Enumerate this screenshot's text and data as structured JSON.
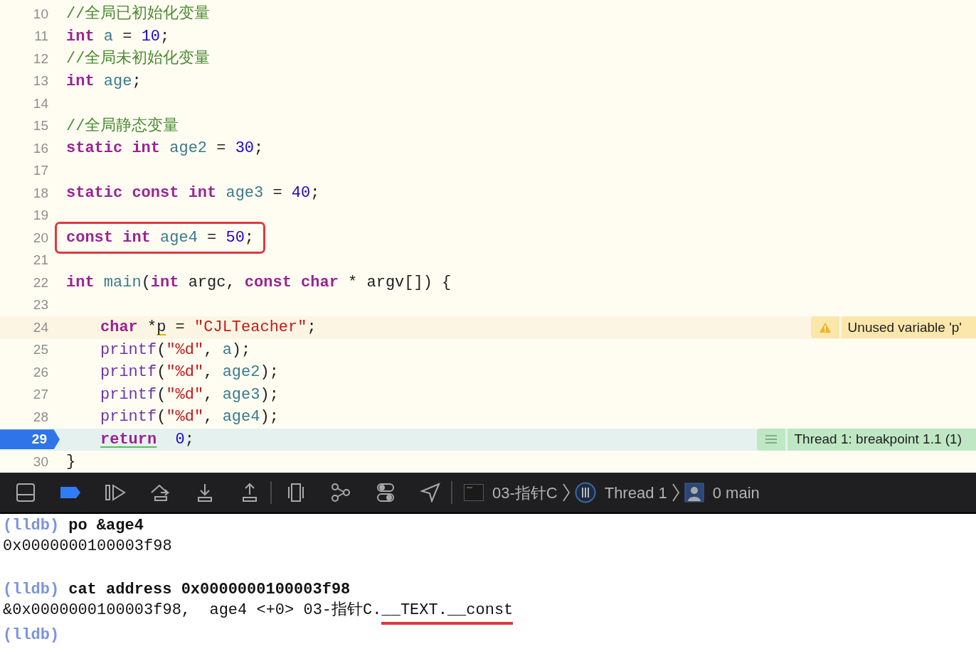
{
  "editor": {
    "lines": [
      {
        "number": "10",
        "tokens": [
          {
            "text": "//全局已初始化变量",
            "kind": "comment"
          }
        ]
      },
      {
        "number": "11",
        "tokens": [
          {
            "text": "int ",
            "kind": "keyword"
          },
          {
            "text": "a",
            "kind": "ident"
          },
          {
            "text": " = ",
            "kind": "plain"
          },
          {
            "text": "10",
            "kind": "number"
          },
          {
            "text": ";",
            "kind": "plain"
          }
        ]
      },
      {
        "number": "12",
        "tokens": [
          {
            "text": "//全局未初始化变量",
            "kind": "comment"
          }
        ]
      },
      {
        "number": "13",
        "tokens": [
          {
            "text": "int ",
            "kind": "keyword"
          },
          {
            "text": "age",
            "kind": "ident"
          },
          {
            "text": ";",
            "kind": "plain"
          }
        ]
      },
      {
        "number": "14"
      },
      {
        "number": "15",
        "tokens": [
          {
            "text": "//全局静态变量",
            "kind": "comment"
          }
        ]
      },
      {
        "number": "16",
        "tokens": [
          {
            "text": "static int ",
            "kind": "keyword"
          },
          {
            "text": "age2",
            "kind": "ident"
          },
          {
            "text": " = ",
            "kind": "plain"
          },
          {
            "text": "30",
            "kind": "number"
          },
          {
            "text": ";",
            "kind": "plain"
          }
        ]
      },
      {
        "number": "17"
      },
      {
        "number": "18",
        "tokens": [
          {
            "text": "static const int ",
            "kind": "keyword"
          },
          {
            "text": "age3",
            "kind": "ident"
          },
          {
            "text": " = ",
            "kind": "plain"
          },
          {
            "text": "40",
            "kind": "number"
          },
          {
            "text": ";",
            "kind": "plain"
          }
        ]
      },
      {
        "number": "19"
      },
      {
        "number": "20",
        "boxed": true,
        "tokens": [
          {
            "text": "const int ",
            "kind": "keyword"
          },
          {
            "text": "age4",
            "kind": "ident"
          },
          {
            "text": " = ",
            "kind": "plain"
          },
          {
            "text": "50",
            "kind": "number"
          },
          {
            "text": ";",
            "kind": "plain"
          }
        ]
      },
      {
        "number": "21"
      },
      {
        "number": "22",
        "tokens": [
          {
            "text": "int ",
            "kind": "keyword"
          },
          {
            "text": "main",
            "kind": "ident"
          },
          {
            "text": "(",
            "kind": "plain"
          },
          {
            "text": "int",
            "kind": "keyword"
          },
          {
            "text": " argc, ",
            "kind": "plain"
          },
          {
            "text": "const char",
            "kind": "keyword"
          },
          {
            "text": " * argv[]) {",
            "kind": "plain"
          }
        ]
      },
      {
        "number": "23"
      },
      {
        "number": "24",
        "indented": true,
        "annotation": {
          "kind": "warning",
          "text": "Unused variable 'p'"
        },
        "tokens": [
          {
            "text": "char",
            "kind": "keyword"
          },
          {
            "text": " *",
            "kind": "plain"
          },
          {
            "text": "p",
            "kind": "plain",
            "underlined": true
          },
          {
            "text": " = ",
            "kind": "plain"
          },
          {
            "text": "\"CJLTeacher\"",
            "kind": "string"
          },
          {
            "text": ";",
            "kind": "plain"
          }
        ]
      },
      {
        "number": "25",
        "indented": true,
        "tokens": [
          {
            "text": "printf",
            "kind": "func"
          },
          {
            "text": "(",
            "kind": "plain"
          },
          {
            "text": "\"%d\"",
            "kind": "string"
          },
          {
            "text": ", ",
            "kind": "plain"
          },
          {
            "text": "a",
            "kind": "ident"
          },
          {
            "text": ");",
            "kind": "plain"
          }
        ]
      },
      {
        "number": "26",
        "indented": true,
        "tokens": [
          {
            "text": "printf",
            "kind": "func"
          },
          {
            "text": "(",
            "kind": "plain"
          },
          {
            "text": "\"%d\"",
            "kind": "string"
          },
          {
            "text": ", ",
            "kind": "plain"
          },
          {
            "text": "age2",
            "kind": "ident"
          },
          {
            "text": ");",
            "kind": "plain"
          }
        ]
      },
      {
        "number": "27",
        "indented": true,
        "tokens": [
          {
            "text": "printf",
            "kind": "func"
          },
          {
            "text": "(",
            "kind": "plain"
          },
          {
            "text": "\"%d\"",
            "kind": "string"
          },
          {
            "text": ", ",
            "kind": "plain"
          },
          {
            "text": "age3",
            "kind": "ident"
          },
          {
            "text": ");",
            "kind": "plain"
          }
        ]
      },
      {
        "number": "28",
        "indented": true,
        "tokens": [
          {
            "text": "printf",
            "kind": "func"
          },
          {
            "text": "(",
            "kind": "plain"
          },
          {
            "text": "\"%d\"",
            "kind": "string"
          },
          {
            "text": ", ",
            "kind": "plain"
          },
          {
            "text": "age4",
            "kind": "ident"
          },
          {
            "text": ");",
            "kind": "plain"
          }
        ]
      },
      {
        "number": "29",
        "indented": true,
        "current": true,
        "annotation": {
          "kind": "breakpoint",
          "text": "Thread 1: breakpoint 1.1 (1)"
        },
        "tokens": [
          {
            "text": "return",
            "kind": "keyword",
            "underlined": true
          },
          {
            "text": "  0",
            "kind": "number"
          },
          {
            "text": ";",
            "kind": "plain"
          }
        ]
      },
      {
        "number": "30",
        "tokens": [
          {
            "text": "}",
            "kind": "plain"
          }
        ]
      }
    ]
  },
  "debug_bar": {
    "buttons": [
      {
        "kind": "hide-console",
        "on": false
      },
      {
        "kind": "breakpoints",
        "on": true
      },
      {
        "kind": "continue",
        "on": false
      },
      {
        "kind": "step-over",
        "on": false
      },
      {
        "kind": "step-into",
        "on": false
      },
      {
        "kind": "step-out",
        "on": false
      },
      {
        "kind": "view-hierarchy",
        "on": false
      },
      {
        "kind": "memory-graph",
        "on": false
      },
      {
        "kind": "environment",
        "on": false
      },
      {
        "kind": "location",
        "on": false
      }
    ],
    "breadcrumbs": [
      {
        "kind": "app",
        "text": "03-指针C"
      },
      {
        "kind": "thread",
        "text": "Thread 1"
      },
      {
        "kind": "frame",
        "text": "0 main"
      }
    ]
  },
  "console": {
    "lines": [
      {
        "kind": "command",
        "prompt": "(lldb)",
        "text": "po &age4"
      },
      {
        "kind": "output",
        "segments": [
          {
            "text": "0x0000000100003f98",
            "marked": false
          }
        ]
      },
      {
        "kind": "blank"
      },
      {
        "kind": "command",
        "prompt": "(lldb)",
        "text": "cat address 0x0000000100003f98"
      },
      {
        "kind": "output",
        "segments": [
          {
            "text": "&0x0000000100003f98,  age4 <+0> 03-指针C.",
            "marked": false
          },
          {
            "text": "__TEXT.__const",
            "marked": true
          }
        ]
      },
      {
        "kind": "command",
        "prompt": "(lldb)"
      }
    ]
  }
}
